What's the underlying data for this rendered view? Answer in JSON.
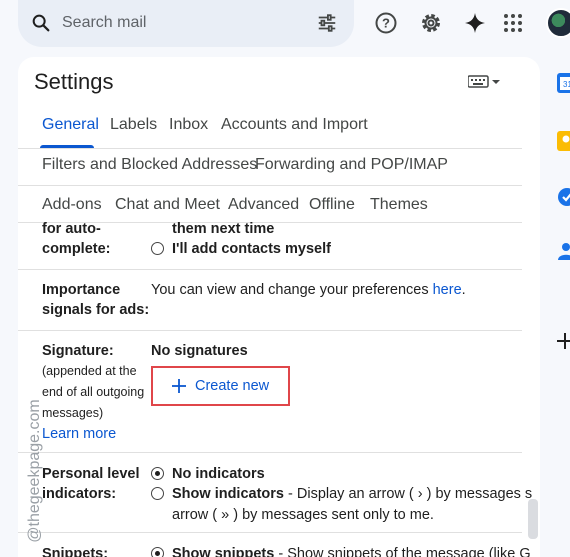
{
  "search": {
    "placeholder": "Search mail"
  },
  "icons": {
    "search": "search-icon",
    "tune": "tune-icon",
    "help": "help-icon",
    "settings": "gear-icon",
    "gemini": "sparkle-icon",
    "apps": "apps-grid-icon"
  },
  "settings": {
    "title": "Settings",
    "tabs_row1": [
      "General",
      "Labels",
      "Inbox",
      "Accounts and Import"
    ],
    "tabs_row2": [
      "Filters and Blocked Addresses",
      "Forwarding and POP/IMAP"
    ],
    "tabs_row3": [
      "Add-ons",
      "Chat and Meet",
      "Advanced",
      "Offline",
      "Themes"
    ],
    "autocomplete": {
      "label": "for auto-complete:",
      "option1": "them next time",
      "option2": "I'll add contacts myself"
    },
    "importance": {
      "label": "Importance signals for ads:",
      "text": "You can view and change your preferences ",
      "link": "here",
      "suffix": "."
    },
    "signature": {
      "label": "Signature:",
      "note": "(appended at the end of all outgoing messages)",
      "learn_more": "Learn more",
      "none": "No signatures",
      "create_new": "Create new"
    },
    "personal": {
      "label": "Personal level indicators:",
      "option1": "No indicators",
      "option2_bold": "Show indicators",
      "option2_text": " - Display an arrow ( › ) by messages s",
      "option2_line2": "arrow ( » ) by messages sent only to me."
    },
    "snippets": {
      "label": "Snippets:",
      "option1_bold": "Show snippets",
      "option1_text": " - Show snippets of the message (like G"
    }
  },
  "watermark": "@thegeekpage.com",
  "colors": {
    "accent": "#0b57d0",
    "highlight_box": "#e0464a"
  }
}
